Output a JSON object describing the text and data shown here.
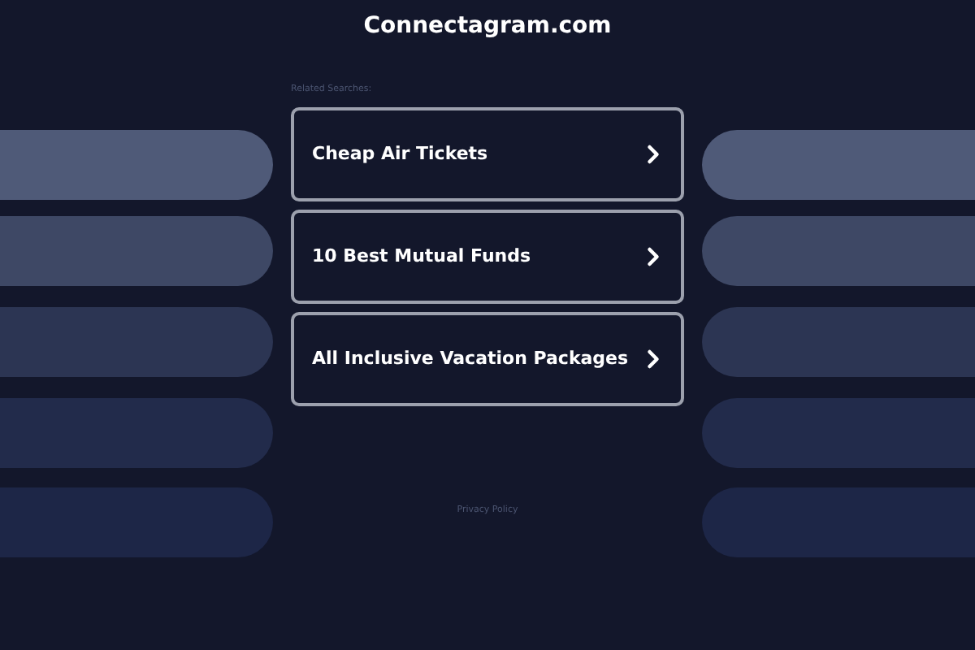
{
  "site_title": "Connectagram.com",
  "related_label": "Related Searches:",
  "links": [
    {
      "label": "Cheap Air Tickets"
    },
    {
      "label": "10 Best Mutual Funds"
    },
    {
      "label": "All Inclusive Vacation Packages"
    }
  ],
  "footer_link": "Privacy Policy"
}
